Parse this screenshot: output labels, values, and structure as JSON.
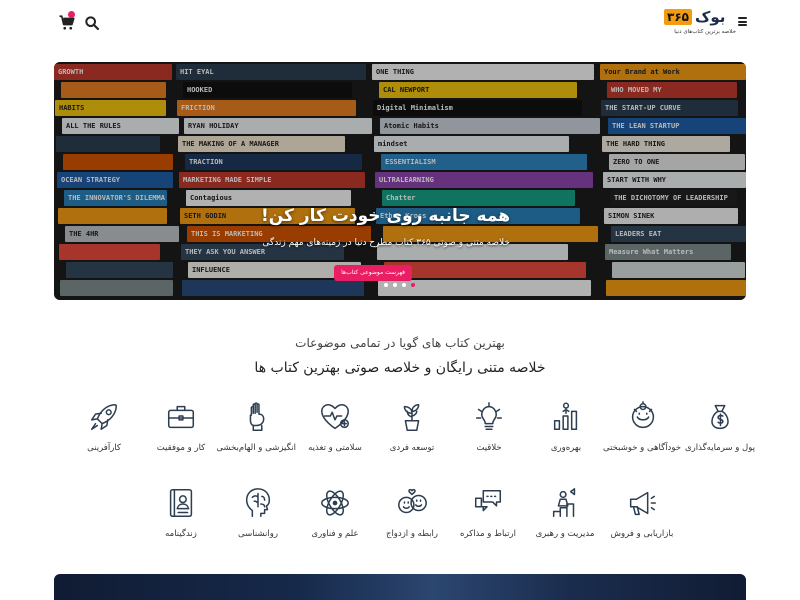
{
  "header": {
    "logo_number": "۳۶۵",
    "logo_word": "بوک",
    "logo_tagline": "خلاصه برترین کتاب‌های دنیا",
    "menu_icon": "hamburger-icon",
    "search_icon": "search-icon",
    "cart_icon": "cart-icon"
  },
  "hero": {
    "title": "همه جانبه روی خودت کار کن!",
    "subtitle": "خلاصه متنی و صوتی ۳۶۵ کتاب مطرح دنیا در زمینه‌های مهم زندگی",
    "button_label": "فهرست موضوعی کتاب‌ها",
    "slides_count": 4,
    "active_slide": 4,
    "book_spines": {
      "left": [
        "GROWTH",
        "",
        "HABITS",
        "ALL THE RULES",
        "",
        "",
        "OCEAN STRATEGY",
        "THE INNOVATOR'S DILEMMA",
        "",
        "THE 4HR",
        ""
      ],
      "middle": [
        "HIT EYAL",
        "HOOKED",
        "FRICTION",
        "RYAN HOLIDAY",
        "THE MAKING OF A MANAGER",
        "TRACTION",
        "MARKETING MADE SIMPLE",
        "Contagious",
        "SETH GODIN",
        "THIS IS MARKETING",
        "THEY ASK YOU ANSWER",
        "INFLUENCE"
      ],
      "right_center": [
        "ONE THING",
        "CAL NEWPORT",
        "Digital Minimalism",
        "Atomic Habits",
        "mindset",
        "ESSENTIALISM",
        "ULTRALEARNING",
        "Chatter",
        "Ethan Kross"
      ],
      "right": [
        "Your Brand at Work",
        "WHO MOVED MY",
        "THE START-UP CURVE",
        "THE LEAN STARTUP",
        "THE HARD THING",
        "ZERO TO ONE",
        "START WITH WHY",
        "THE DICHOTOMY OF LEADERSHIP",
        "SIMON SINEK",
        "LEADERS EAT",
        "Measure What Matters"
      ]
    }
  },
  "section": {
    "subtitle": "بهترین کتاب های گویا در تمامی موضوعات",
    "title": "خلاصه متنی رایگان و خلاصه صوتی بهترین کتاب ها"
  },
  "categories": [
    {
      "label": "پول و سرمایه‌گذاری",
      "icon": "money-bag-icon"
    },
    {
      "label": "خودآگاهی و خوشبختی",
      "icon": "head-gears-icon"
    },
    {
      "label": "بهره‌وری",
      "icon": "productivity-icon"
    },
    {
      "label": "خلاقیت",
      "icon": "lightbulb-icon"
    },
    {
      "label": "توسعه فردی",
      "icon": "plant-icon"
    },
    {
      "label": "سلامتی و تغذیه",
      "icon": "heart-pulse-icon"
    },
    {
      "label": "انگیزشی و الهام‌بخشی",
      "icon": "raised-fist-icon"
    },
    {
      "label": "کار و موفقیت",
      "icon": "briefcase-icon"
    },
    {
      "label": "کارآفرینی",
      "icon": "rocket-icon"
    },
    {
      "label": "بازاریابی و فروش",
      "icon": "megaphone-icon"
    },
    {
      "label": "مدیریت و رهبری",
      "icon": "leadership-icon"
    },
    {
      "label": "ارتباط و مذاکره",
      "icon": "chat-bubbles-icon"
    },
    {
      "label": "رابطه و ازدواج",
      "icon": "couple-faces-icon"
    },
    {
      "label": "علم و فناوری",
      "icon": "atom-icon"
    },
    {
      "label": "روانشناسی",
      "icon": "brain-head-icon"
    },
    {
      "label": "زندگینامه",
      "icon": "biography-book-icon"
    }
  ],
  "colors": {
    "accent": "#e91e63",
    "logo_orange": "#f39c12",
    "logo_navy": "#1b2a4a",
    "icon_stroke": "#2c3e50"
  }
}
